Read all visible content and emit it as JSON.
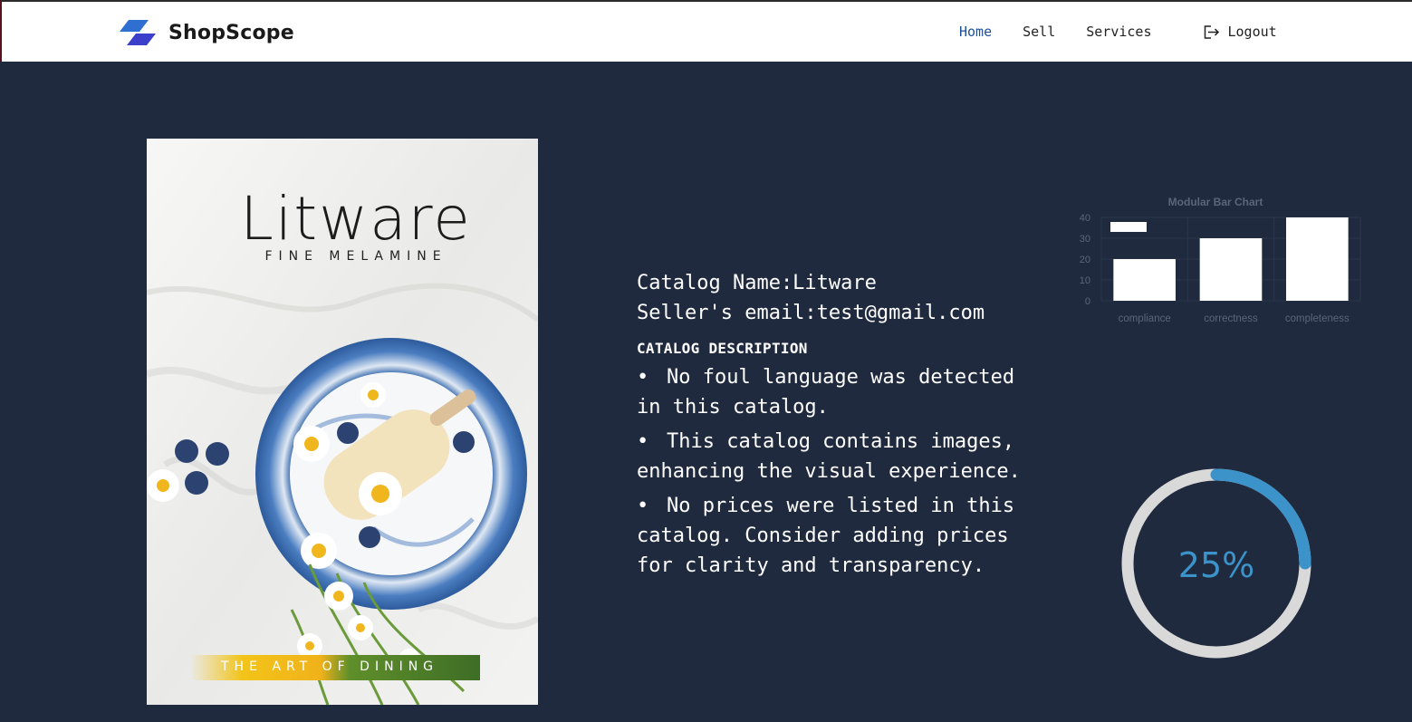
{
  "app": {
    "brand": "ShopScope",
    "accent": "#1f4f9a"
  },
  "nav": {
    "home": "Home",
    "sell": "Sell",
    "services": "Services",
    "logout": "Logout",
    "logout_icon": "logout-icon"
  },
  "cover": {
    "title": "Litware",
    "subtitle": "FINE MELAMINE",
    "tagline": "THE ART OF DINING"
  },
  "catalog": {
    "name_line": "Catalog Name:Litware",
    "email_line": "Seller's email:test@gmail.com",
    "description_heading": "CATALOG DESCRIPTION",
    "bullets": [
      "No foul language was detected in this catalog.",
      "This catalog contains images, enhancing the visual experience.",
      "No prices were listed in this catalog. Consider adding prices for clarity and transparency."
    ]
  },
  "chart_data": {
    "type": "bar",
    "title": "Modular Bar Chart",
    "categories": [
      "compliance",
      "correctness",
      "completeness"
    ],
    "values": [
      20,
      30,
      40
    ],
    "ylim": [
      0,
      40
    ],
    "yticks": [
      0,
      10,
      20,
      30,
      40
    ],
    "legend": "top-left",
    "grid": true,
    "bar_color": "#ffffff",
    "text_color": "#5b6678"
  },
  "progress": {
    "value": 0.25,
    "label": "25%",
    "track_color": "#d9d9d9",
    "fill_color": "#3b93c9"
  }
}
